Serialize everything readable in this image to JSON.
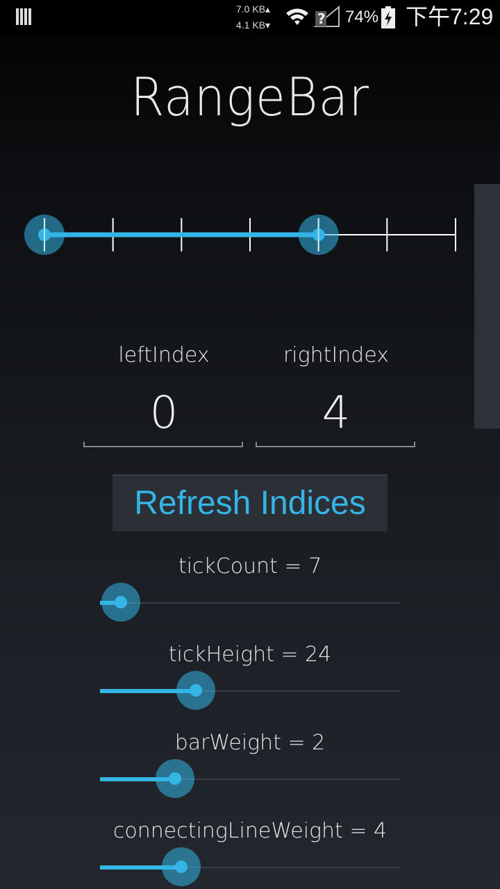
{
  "status_bar": {
    "net_up": "7.0 KB▴",
    "net_down": "4.1 KB▾",
    "battery_pct": "74%",
    "clock": "下午7:29"
  },
  "title": "RangeBar",
  "rangebar": {
    "tick_count": 7,
    "left_index": 0,
    "right_index": 4,
    "active_color": "#35b5e5",
    "bar_color": "#ffffff"
  },
  "indices": {
    "left_label": "leftIndex",
    "left_value": "0",
    "right_label": "rightIndex",
    "right_value": "4"
  },
  "refresh_button": {
    "label": "Refresh Indices"
  },
  "sliders": [
    {
      "label": "tickCount = 7",
      "fraction": 0.07
    },
    {
      "label": "tickHeight = 24",
      "fraction": 0.32
    },
    {
      "label": "barWeight = 2",
      "fraction": 0.25
    },
    {
      "label": "connectingLineWeight = 4",
      "fraction": 0.27
    }
  ],
  "colors": {
    "accent": "#35b5e5",
    "button_bg": "#2b3037"
  }
}
